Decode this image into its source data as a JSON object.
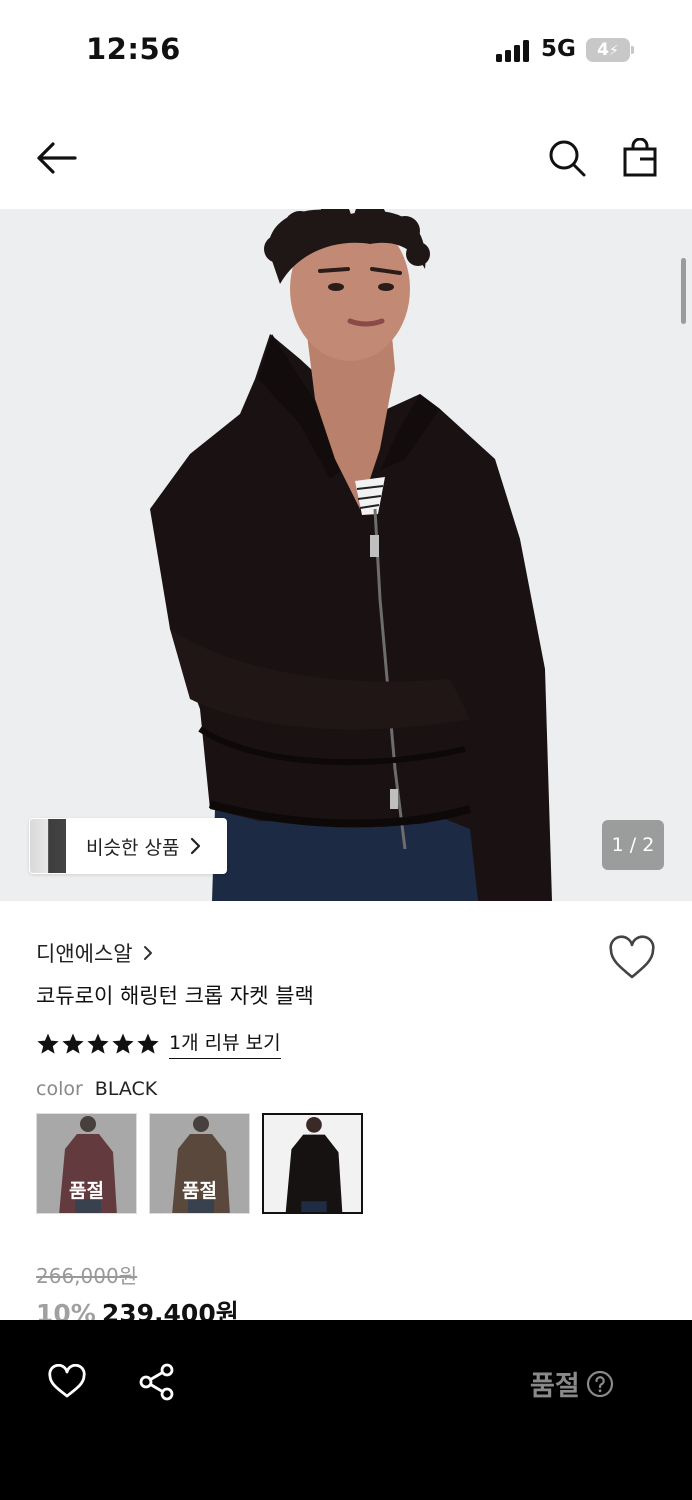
{
  "status_bar": {
    "time": "12:56",
    "network": "5G",
    "battery": "4"
  },
  "nav": {
    "back_icon": "arrow-left-icon",
    "search_icon": "search-icon",
    "bag_icon": "shopping-bag-icon"
  },
  "gallery": {
    "similar_label": "비슷한 상품",
    "counter": "1 / 2"
  },
  "product": {
    "brand": "디앤에스알",
    "name": "코듀로이 해링턴 크롭 자켓 블랙",
    "rating_stars": 5,
    "review_link": "1개 리뷰 보기",
    "color_key": "color",
    "color_value": "BLACK",
    "swatches": [
      {
        "soldout": "품절",
        "tone": "#6b1f26"
      },
      {
        "soldout": "품절",
        "tone": "#5b3a24"
      },
      {
        "soldout": "",
        "tone": "#161212"
      }
    ],
    "original_price": "266,000원",
    "discount": "10%",
    "sale_price": "239,400원"
  },
  "bottom_bar": {
    "status": "품절",
    "heart_icon": "heart-icon",
    "share_icon": "share-icon",
    "help_icon": "question-circle-icon"
  }
}
